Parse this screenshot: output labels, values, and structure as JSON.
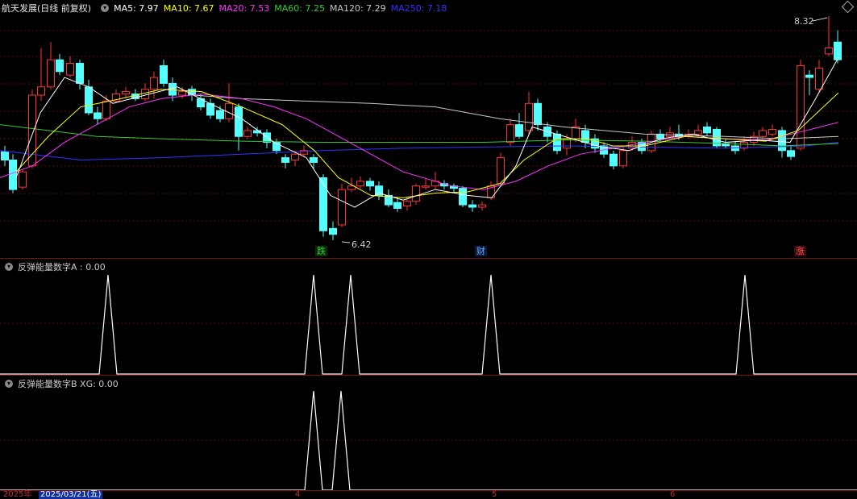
{
  "main": {
    "title": "航天发展(日线 前复权)",
    "ma": [
      {
        "label": "MA5: 7.97",
        "color": "#ffffff"
      },
      {
        "label": "MA10: 7.67",
        "color": "#ffff00"
      },
      {
        "label": "MA20: 7.53",
        "color": "#ff33ff"
      },
      {
        "label": "MA60: 7.25",
        "color": "#33cc33"
      },
      {
        "label": "MA120: 7.29",
        "color": "#c8c8c8"
      },
      {
        "label": "MA250: 7.18",
        "color": "#3333ff"
      }
    ],
    "high_label": "8.32",
    "low_label": "6.42",
    "tags": [
      {
        "text": "跌",
        "color": "#33cc33",
        "bg": "#0a2a0a"
      },
      {
        "text": "财",
        "color": "#66aaff",
        "bg": "#0a1a3a"
      },
      {
        "text": "涨",
        "color": "#ff5555",
        "bg": "#3a0a0a"
      }
    ],
    "corner_icon": "diamond-icon"
  },
  "ind1": {
    "title": "反弹能量数字A : 0.00"
  },
  "ind2": {
    "title": "反弹能量数字B XG: 0.00"
  },
  "dates": {
    "start": "2025年",
    "selected": "2025/03/21(五)",
    "m4": "4",
    "m5": "5",
    "m6": "6"
  },
  "colors": {
    "up": "#ff3333",
    "down": "#54ffff",
    "bg": "#000000",
    "grid": "#7a1010"
  }
}
